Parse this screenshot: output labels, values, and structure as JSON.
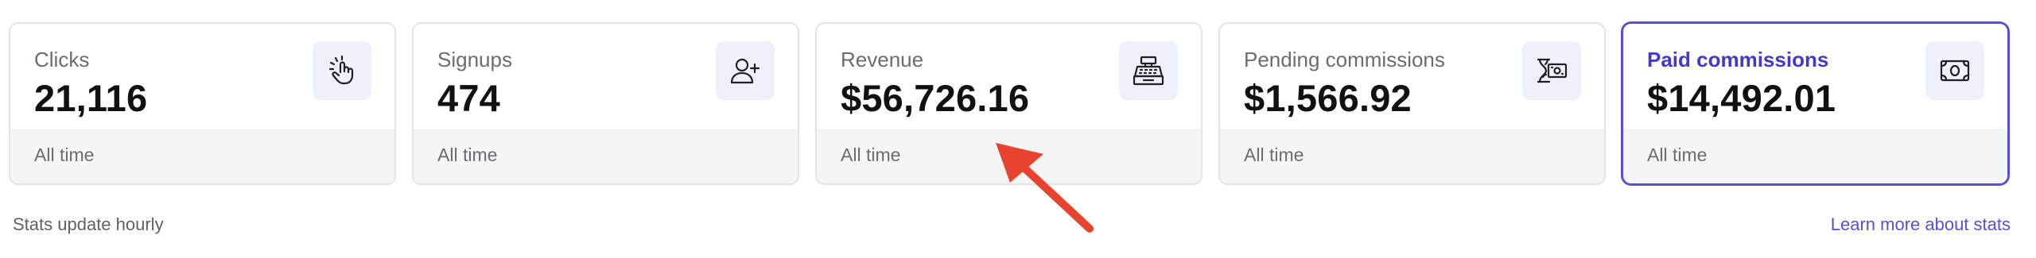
{
  "stats": [
    {
      "label": "Clicks",
      "value": "21,116",
      "footer": "All time",
      "icon": "pointer-click-icon"
    },
    {
      "label": "Signups",
      "value": "474",
      "footer": "All time",
      "icon": "user-plus-icon"
    },
    {
      "label": "Revenue",
      "value": "$56,726.16",
      "footer": "All time",
      "icon": "cash-register-icon"
    },
    {
      "label": "Pending commissions",
      "value": "$1,566.92",
      "footer": "All time",
      "icon": "money-hourglass-icon"
    },
    {
      "label": "Paid commissions",
      "value": "$14,492.01",
      "footer": "All time",
      "icon": "banknote-icon"
    }
  ],
  "active_card": "Paid commissions",
  "footer_note": "Stats update hourly",
  "learn_more": "Learn more about stats",
  "colors": {
    "accent": "#5b4dd6",
    "arrow": "#e8432e",
    "icon_bg": "#eef0fb"
  }
}
